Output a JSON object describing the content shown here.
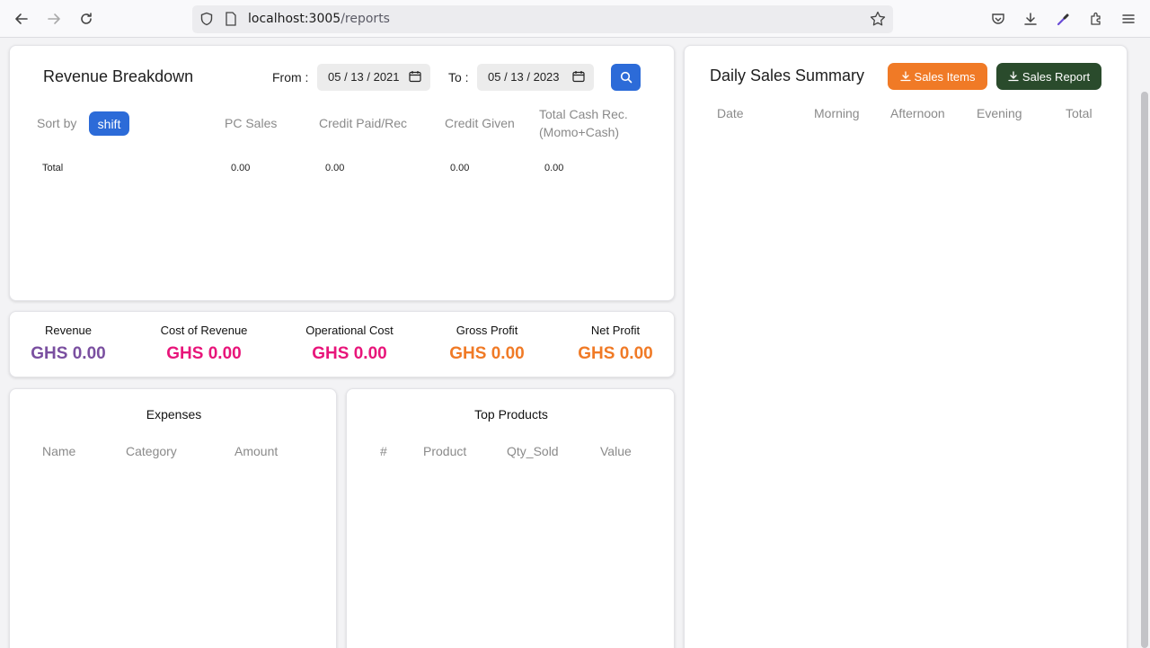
{
  "browser": {
    "url_host": "localhost:3005",
    "url_path": "/reports"
  },
  "revenue_breakdown": {
    "title": "Revenue Breakdown",
    "from_label": "From :",
    "from_value": "05 / 13 / 2021",
    "to_label": "To :",
    "to_value": "05 / 13 / 2023",
    "sort_by_label": "Sort by",
    "sort_chip": "shift",
    "columns": [
      "PC Sales",
      "Credit Paid/Rec",
      "Credit Given",
      "Total Cash Rec.",
      "(Momo+Cash)"
    ],
    "total_row": {
      "label": "Total",
      "pc_sales": "0.00",
      "credit_paid": "0.00",
      "credit_given": "0.00",
      "total_cash": "0.00"
    }
  },
  "stats": [
    {
      "title": "Revenue",
      "value": "GHS 0.00",
      "color": "#7a4fa0"
    },
    {
      "title": "Cost of Revenue",
      "value": "GHS 0.00",
      "color": "#e8157a"
    },
    {
      "title": "Operational Cost",
      "value": "GHS 0.00",
      "color": "#e8157a"
    },
    {
      "title": "Gross Profit",
      "value": "GHS 0.00",
      "color": "#f07a26"
    },
    {
      "title": "Net Profit",
      "value": "GHS 0.00",
      "color": "#f07a26"
    }
  ],
  "expenses": {
    "title": "Expenses",
    "columns": [
      "Name",
      "Category",
      "Amount"
    ]
  },
  "top_products": {
    "title": "Top Products",
    "columns": [
      "#",
      "Product",
      "Qty_Sold",
      "Value"
    ]
  },
  "daily_sales": {
    "title": "Daily Sales Summary",
    "sales_items_button": "Sales Items",
    "sales_report_button": "Sales Report",
    "columns": [
      "Date",
      "Morning",
      "Afternoon",
      "Evening",
      "Total"
    ]
  },
  "colors": {
    "primary_blue": "#2c6bd8",
    "orange": "#f07a26",
    "dark_green": "#2a4b2c"
  }
}
